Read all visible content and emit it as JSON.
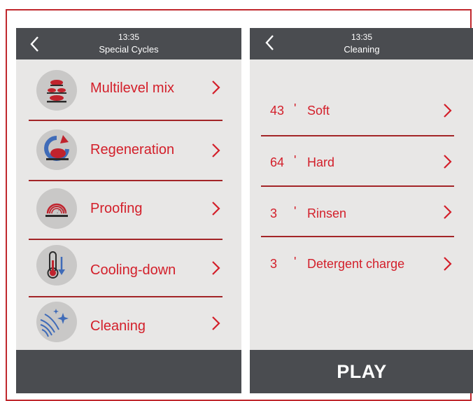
{
  "left_screen": {
    "time": "13:35",
    "title": "Special Cycles",
    "items": [
      {
        "label": "Multilevel mix",
        "icon": "multilevel-mix-icon"
      },
      {
        "label": "Regeneration",
        "icon": "regeneration-icon"
      },
      {
        "label": "Proofing",
        "icon": "proofing-icon"
      },
      {
        "label": "Cooling-down",
        "icon": "cooling-down-icon"
      },
      {
        "label": "Cleaning",
        "icon": "cleaning-icon"
      }
    ]
  },
  "right_screen": {
    "time": "13:35",
    "title": "Cleaning",
    "items": [
      {
        "minutes": "43",
        "unit": "'",
        "label": "Soft"
      },
      {
        "minutes": "64",
        "unit": "'",
        "label": "Hard"
      },
      {
        "minutes": "3",
        "unit": "'",
        "label": "Rinsen"
      },
      {
        "minutes": "3",
        "unit": "'",
        "label": "Detergent charge"
      }
    ],
    "play_label": "PLAY"
  },
  "colors": {
    "accent": "#d31f2a",
    "separator": "#a32528",
    "header": "#4a4c50",
    "background": "#e8e7e6",
    "frame": "#c0282d"
  }
}
